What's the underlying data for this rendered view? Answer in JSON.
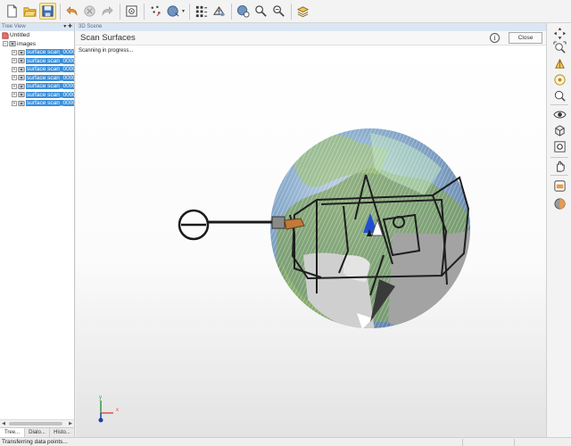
{
  "toolbar": {
    "buttons": [
      {
        "name": "new-file-icon"
      },
      {
        "name": "open-folder-icon"
      },
      {
        "name": "save-icon"
      },
      {
        "name": "undo-icon"
      },
      {
        "name": "cut-icon"
      },
      {
        "name": "redo-icon"
      },
      {
        "name": "capture-icon"
      },
      {
        "name": "point-pick-icon"
      },
      {
        "name": "globe-point-icon"
      },
      {
        "name": "grid-points-icon"
      },
      {
        "name": "mesh-icon"
      },
      {
        "name": "georef-icon"
      },
      {
        "name": "magnify-icon"
      },
      {
        "name": "zoom-region-icon"
      },
      {
        "name": "layers-icon"
      }
    ]
  },
  "tree_panel": {
    "title": "Tree View",
    "root": "Untitled",
    "group": "images",
    "items": [
      "surface scan_0000",
      "surface scan_0000",
      "surface scan_0000",
      "surface scan_0000",
      "surface scan_0000",
      "surface scan_0000",
      "surface scan_0000"
    ],
    "tabs": [
      "Tree...",
      "Dialo...",
      "Histo..."
    ]
  },
  "scene": {
    "title": "3D Scene",
    "dialog_title": "Scan Surfaces",
    "info_label": "i",
    "close_label": "Close",
    "message": "Scanning in progress...",
    "axis_x": "x",
    "axis_y": "y"
  },
  "right_toolbar": {
    "buttons": [
      "navigate-icon",
      "zoom-extents-icon",
      "pyramid-icon",
      "target-icon",
      "zoom-fit-icon",
      "visibility-eye-icon",
      "cube-view-icon",
      "camera-settings-icon",
      "hand-pan-icon",
      "clip-box-icon",
      "shading-icon"
    ]
  },
  "status": {
    "text": "Transferring data points..."
  },
  "colors": {
    "accent": "#3b8fd9",
    "panel_title_bg": "#dbe6f3",
    "sphere_blue": "#6f95c4",
    "sphere_green": "#7ea25c",
    "scan_gray": "#9a9a9a"
  }
}
